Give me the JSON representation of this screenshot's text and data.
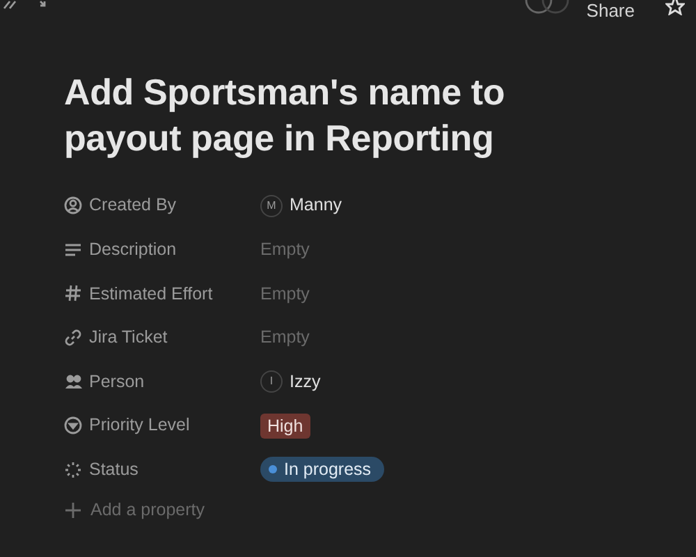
{
  "topbar": {
    "share": "Share"
  },
  "page": {
    "title": "Add Sportsman's name to payout page in Reporting"
  },
  "properties": [
    {
      "kind": "created_by",
      "label": "Created By",
      "value": {
        "kind": "person",
        "initial": "M",
        "text": "Manny"
      }
    },
    {
      "kind": "text",
      "label": "Description",
      "value": {
        "kind": "empty",
        "text": "Empty"
      }
    },
    {
      "kind": "number",
      "label": "Estimated Effort",
      "value": {
        "kind": "empty",
        "text": "Empty"
      }
    },
    {
      "kind": "url",
      "label": "Jira Ticket",
      "value": {
        "kind": "empty",
        "text": "Empty"
      }
    },
    {
      "kind": "person",
      "label": "Person",
      "value": {
        "kind": "person",
        "initial": "I",
        "text": "Izzy"
      }
    },
    {
      "kind": "select",
      "label": "Priority Level",
      "value": {
        "kind": "tag",
        "text": "High",
        "color": "#6e3630"
      }
    },
    {
      "kind": "status",
      "label": "Status",
      "value": {
        "kind": "status",
        "text": "In progress",
        "color": "#4a8fd8"
      }
    }
  ],
  "add_property": "Add a property"
}
